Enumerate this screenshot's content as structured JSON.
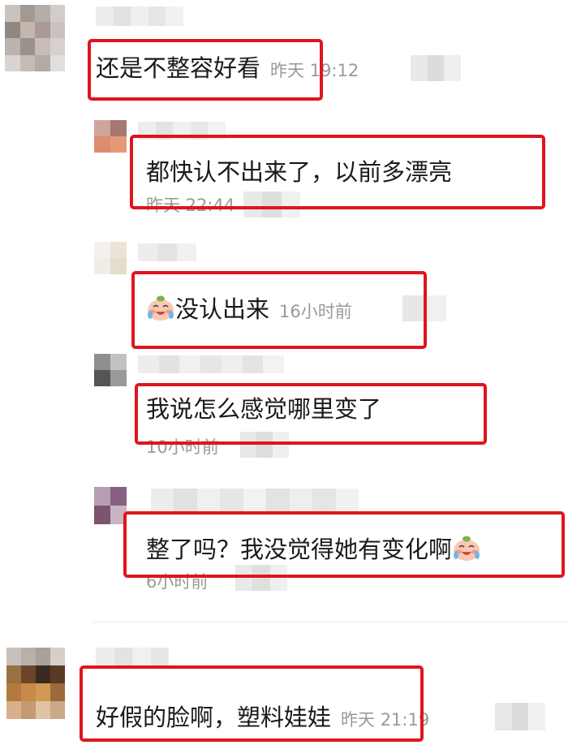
{
  "comments": [
    {
      "text": "还是不整容好看",
      "time": "昨天 19:12"
    },
    {
      "text": "都快认不出来了，以前多漂亮",
      "time": "昨天 22:44"
    },
    {
      "text": "没认出来",
      "time": "16小时前",
      "emoji": "crying-laugh-emoji"
    },
    {
      "text": "我说怎么感觉哪里变了",
      "time": "10小时前"
    },
    {
      "text": "整了吗？我没觉得她有变化啊",
      "time": "6小时前",
      "emoji": "crying-laugh-emoji"
    },
    {
      "text": "好假的脸啊，塑料娃娃",
      "time": "昨天 21:19"
    }
  ],
  "colors": {
    "highlight_border": "#e0141e",
    "text": "#1a1a1a",
    "meta": "#9a9a9a"
  }
}
